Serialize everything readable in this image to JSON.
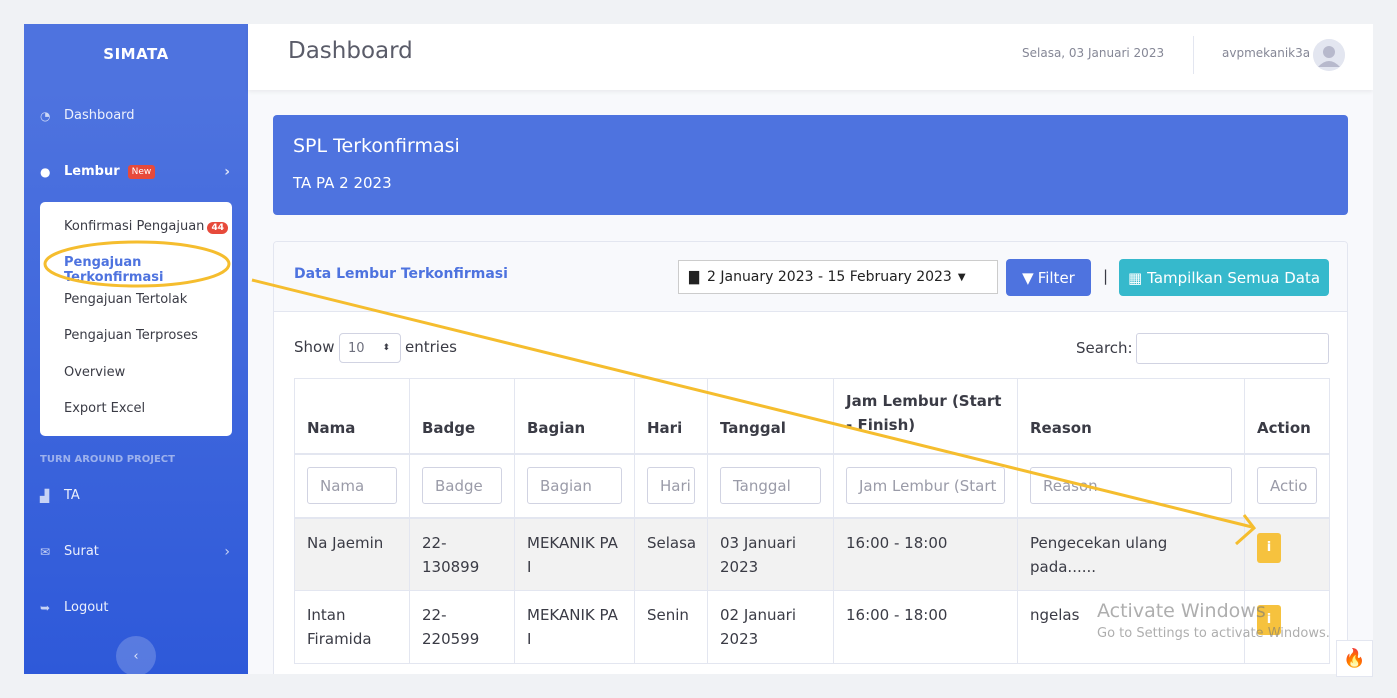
{
  "sidebar": {
    "brand": "SIMATA",
    "items": {
      "dashboard": "Dashboard",
      "lembur": "Lembur",
      "lembur_badge": "New",
      "heading": "TURN AROUND PROJECT",
      "ta": "TA",
      "surat": "Surat",
      "logout": "Logout"
    },
    "submenu": [
      {
        "label": "Konfirmasi Pengajuan",
        "count": "44"
      },
      {
        "label": "Pengajuan Terkonfirmasi"
      },
      {
        "label": "Pengajuan Tertolak"
      },
      {
        "label": "Pengajuan Terproses"
      },
      {
        "label": "Overview"
      },
      {
        "label": "Export Excel"
      }
    ]
  },
  "topbar": {
    "title": "Dashboard",
    "date": "Selasa, 03 Januari 2023",
    "user": "avpmekanik3a"
  },
  "header": {
    "title": "SPL Terkonfirmasi",
    "subtitle": "TA PA 2 2023"
  },
  "card": {
    "title": "Data Lembur Terkonfirmasi",
    "date_range": "2 January 2023 - 15 February 2023",
    "filter_label": "Filter",
    "separator": "|",
    "show_all_label": "Tampilkan Semua Data"
  },
  "table_controls": {
    "show": "Show",
    "page_size": "10",
    "entries": "entries",
    "search": "Search:"
  },
  "table": {
    "headers": [
      "Nama",
      "Badge",
      "Bagian",
      "Hari",
      "Tanggal",
      "Jam Lembur (Start - Finish)",
      "Reason",
      "Action"
    ],
    "filters": [
      "Nama",
      "Badge",
      "Bagian",
      "Hari",
      "Tanggal",
      "Jam Lembur (Start",
      "Reason",
      "Actio"
    ],
    "rows": [
      {
        "nama": "Na Jaemin",
        "badge": "22-130899",
        "bagian": "MEKANIK PA I",
        "hari": "Selasa",
        "tanggal": "03 Januari 2023",
        "jam": "16:00 - 18:00",
        "reason": "Pengecekan ulang pada......",
        "action": "i"
      },
      {
        "nama": "Intan Firamida",
        "badge": "22-220599",
        "bagian": "MEKANIK PA I",
        "hari": "Senin",
        "tanggal": "02 Januari 2023",
        "jam": "16:00 - 18:00",
        "reason": "ngelas",
        "action": "i"
      }
    ]
  },
  "watermark": {
    "line1": "Activate Windows",
    "line2": "Go to Settings to activate Windows."
  },
  "annotation_color": "#f5bd2e"
}
